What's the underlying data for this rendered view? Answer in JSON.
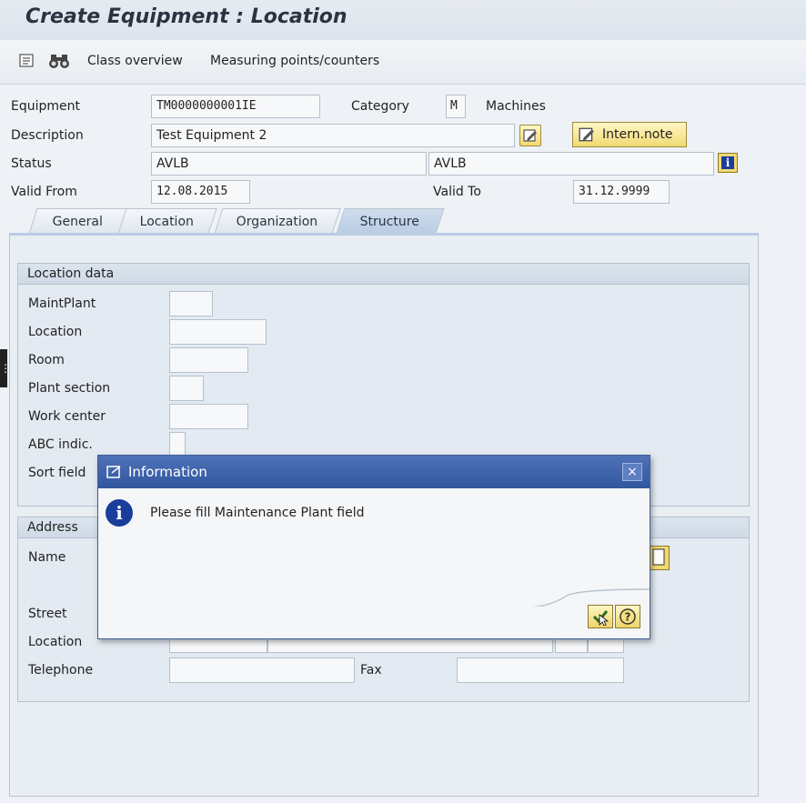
{
  "window": {
    "title": "Create Equipment : Location"
  },
  "toolbar": {
    "class_overview": "Class overview",
    "measuring_points": "Measuring points/counters"
  },
  "header": {
    "equipment_label": "Equipment",
    "equipment_value": "TM0000000001IE",
    "category_label": "Category",
    "category_value": "M",
    "category_text": "Machines",
    "description_label": "Description",
    "description_value": "Test Equipment 2",
    "intern_note": "Intern.note",
    "status_label": "Status",
    "status_value": "AVLB",
    "status_value2": "AVLB",
    "valid_from_label": "Valid From",
    "valid_from_value": "12.08.2015",
    "valid_to_label": "Valid To",
    "valid_to_value": "31.12.9999"
  },
  "tabs": [
    {
      "label": "General"
    },
    {
      "label": "Location"
    },
    {
      "label": "Organization"
    },
    {
      "label": "Structure"
    }
  ],
  "location_data": {
    "title": "Location data",
    "maint_plant": "MaintPlant",
    "location": "Location",
    "room": "Room",
    "plant_section": "Plant section",
    "work_center": "Work center",
    "abc_indic": "ABC indic.",
    "sort_field": "Sort field"
  },
  "address": {
    "title": "Address",
    "name": "Name",
    "street": "Street",
    "location": "Location",
    "telephone": "Telephone",
    "fax": "Fax"
  },
  "dialog": {
    "title": "Information",
    "message": "Please fill Maintenance Plant field"
  },
  "colors": {
    "dialog_title": "#31569f",
    "button_yellow": "#f1da72",
    "info_blue": "#1a3d9c"
  }
}
